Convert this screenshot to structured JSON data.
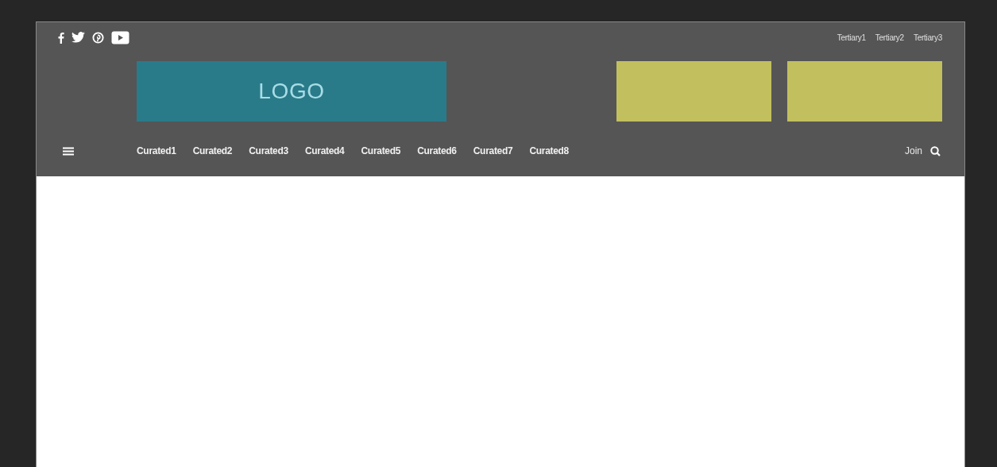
{
  "tertiary_links": [
    "Tertiary1",
    "Tertiary2",
    "Tertiary3"
  ],
  "logo": {
    "label": "LOGO"
  },
  "nav": {
    "items": [
      "Curated1",
      "Curated2",
      "Curated3",
      "Curated4",
      "Curated5",
      "Curated6",
      "Curated7",
      "Curated8"
    ],
    "join": "Join"
  }
}
